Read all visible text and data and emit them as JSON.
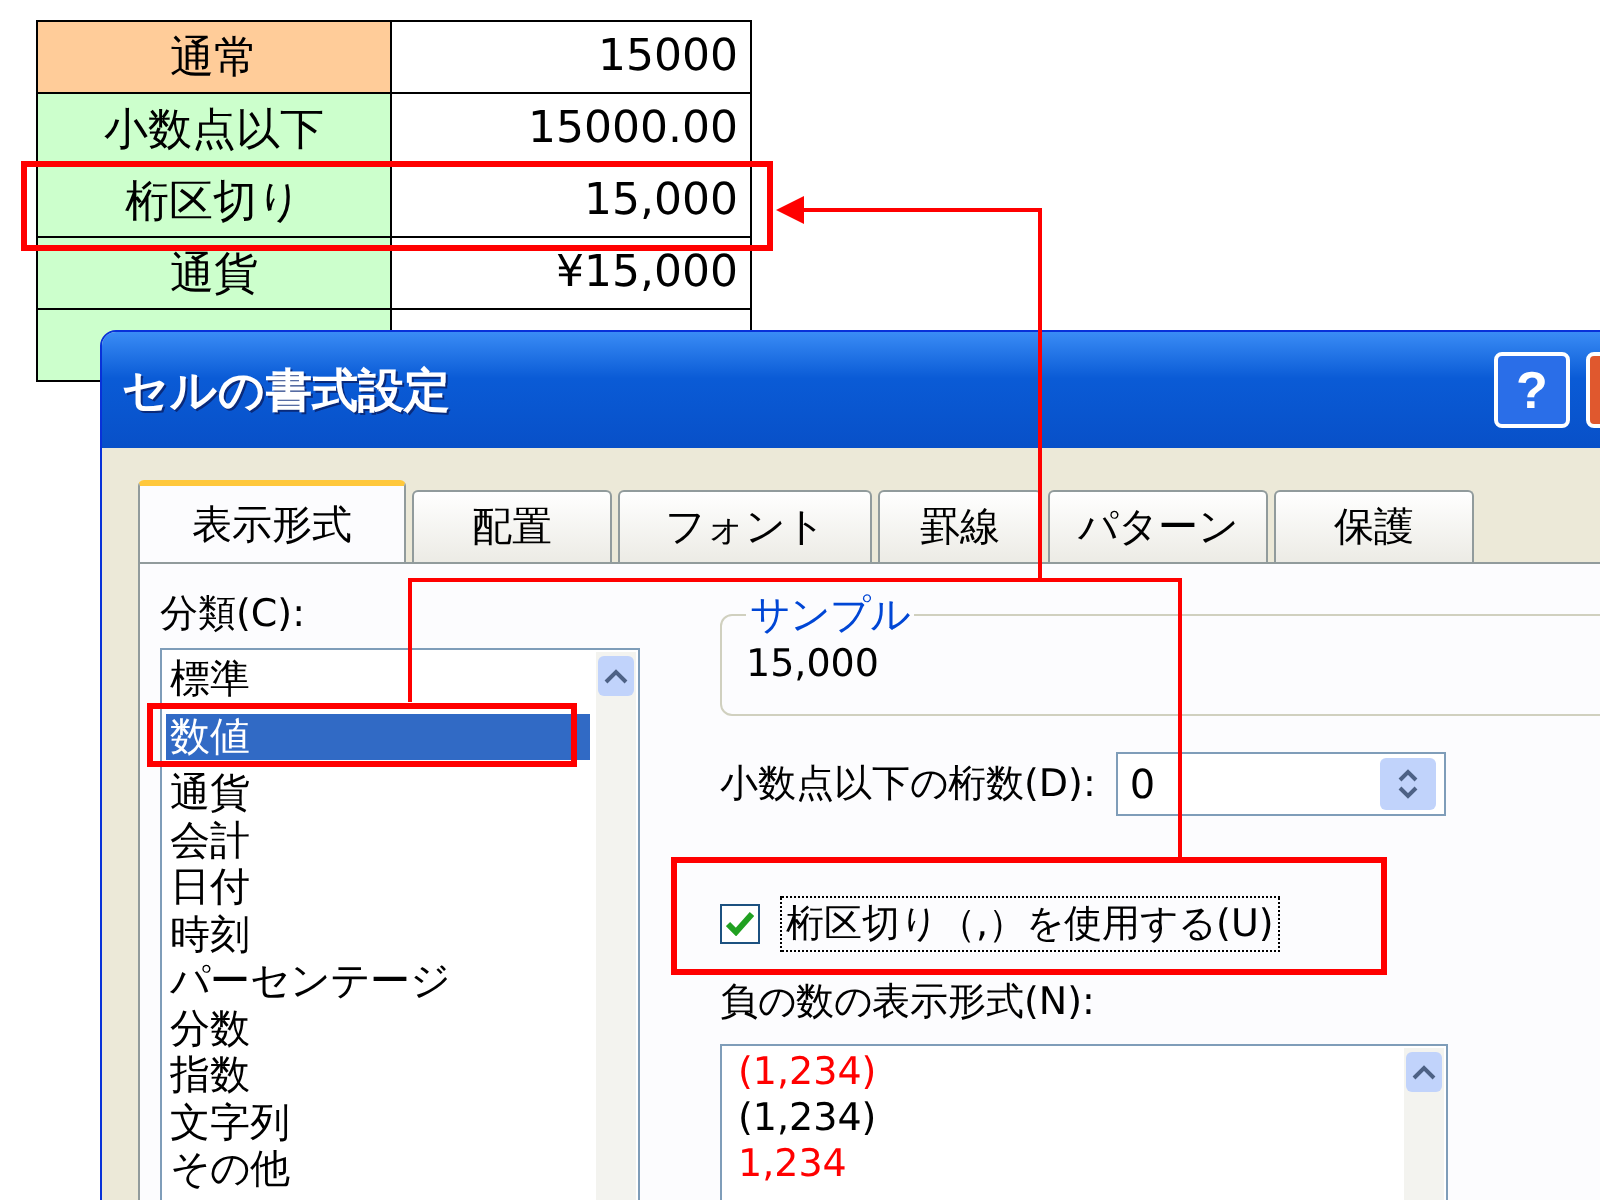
{
  "sheet": {
    "rows": [
      {
        "label": "通常",
        "value": "15000",
        "color": "#ffcc99"
      },
      {
        "label": "小数点以下",
        "value": "15000.00",
        "color": "#ccffcc"
      },
      {
        "label": "桁区切り",
        "value": "15,000",
        "color": "#ccffcc"
      },
      {
        "label": "通貨",
        "value": "¥15,000",
        "color": "#ccffcc"
      }
    ]
  },
  "dialog": {
    "title": "セルの書式設定",
    "help_button": "?",
    "tabs": [
      {
        "label": "表示形式",
        "selected": true
      },
      {
        "label": "配置",
        "selected": false
      },
      {
        "label": "フォント",
        "selected": false
      },
      {
        "label": "罫線",
        "selected": false
      },
      {
        "label": "パターン",
        "selected": false
      },
      {
        "label": "保護",
        "selected": false
      }
    ],
    "category_label": "分類(C):",
    "categories": [
      {
        "label": "標準",
        "selected": false
      },
      {
        "label": "数値",
        "selected": true
      },
      {
        "label": "通貨",
        "selected": false
      },
      {
        "label": "会計",
        "selected": false
      },
      {
        "label": "日付",
        "selected": false
      },
      {
        "label": "時刻",
        "selected": false
      },
      {
        "label": "パーセンテージ",
        "selected": false
      },
      {
        "label": "分数",
        "selected": false
      },
      {
        "label": "指数",
        "selected": false
      },
      {
        "label": "文字列",
        "selected": false
      },
      {
        "label": "その他",
        "selected": false
      }
    ],
    "sample": {
      "legend": "サンプル",
      "value": "15,000"
    },
    "decimal_places": {
      "label": "小数点以下の桁数(D):",
      "value": "0"
    },
    "thousands_separator": {
      "label": "桁区切り（,）を使用する(U)",
      "checked": true
    },
    "negative_format": {
      "label": "負の数の表示形式(N):",
      "items": [
        {
          "label": "(1,234)",
          "color": "#ff0000"
        },
        {
          "label": "(1,234)",
          "color": "#000000"
        },
        {
          "label": "1,234",
          "color": "#ff0000"
        }
      ]
    }
  }
}
